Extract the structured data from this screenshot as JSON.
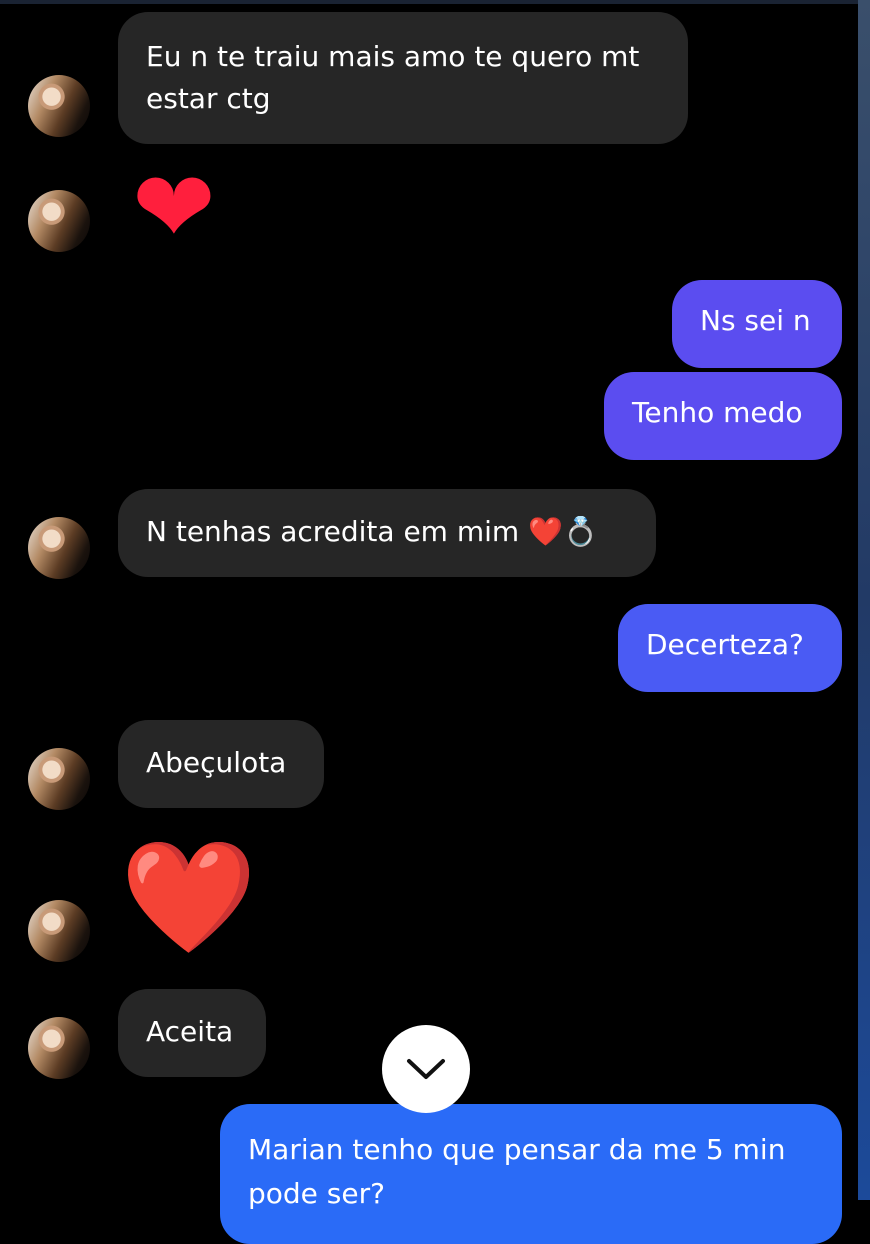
{
  "messages": [
    {
      "side": "in",
      "text": "Eu n te traiu mais amo te quero mt\nestar ctg"
    },
    {
      "side": "in",
      "emoji": "❤"
    },
    {
      "side": "out",
      "text": "Ns sei n",
      "color": "#5b4df0"
    },
    {
      "side": "out",
      "text": "Tenho medo",
      "color": "#5b4df0"
    },
    {
      "side": "in",
      "text": "N tenhas acredita em mim",
      "trailing_emoji": "❤️💍"
    },
    {
      "side": "out",
      "text": "Decerteza?",
      "color": "#4a5bf4"
    },
    {
      "side": "in",
      "text": "Abeçulota"
    },
    {
      "side": "in",
      "emoji": "❤️"
    },
    {
      "side": "in",
      "text": "Aceita"
    },
    {
      "side": "out",
      "text": "Marian tenho que pensar da me 5 min\npode ser?",
      "color": "#2a6bf7"
    }
  ],
  "scroll_button": {
    "icon": "chevron-down-icon"
  },
  "colors": {
    "incoming_bubble": "#262626",
    "background": "#000000",
    "heart": "#ff1f3d"
  }
}
